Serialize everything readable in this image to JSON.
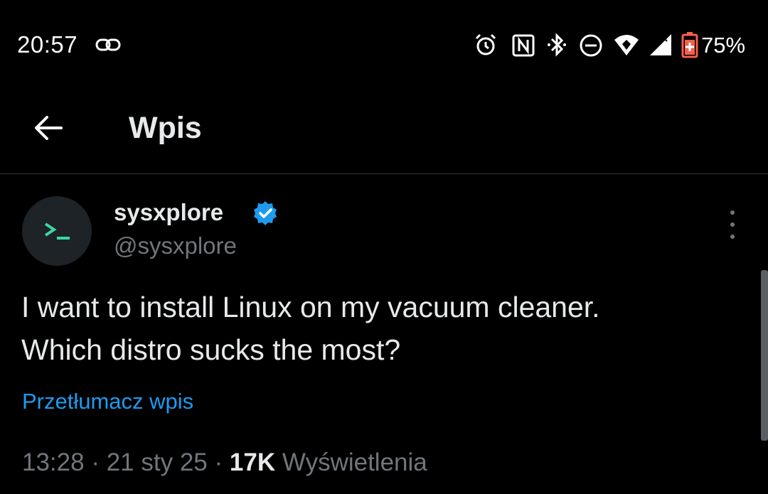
{
  "status_bar": {
    "time": "20:57",
    "battery": "75%",
    "icons": [
      "link-icon",
      "alarm-icon",
      "nfc-icon",
      "bluetooth-icon",
      "do-not-disturb-icon",
      "wifi-icon",
      "signal-icon",
      "battery-icon"
    ]
  },
  "header": {
    "back_icon": "arrow-left-icon",
    "title": "Wpis"
  },
  "post": {
    "author": {
      "display_name": "sysxplore",
      "handle": "@sysxplore",
      "verified": true,
      "avatar_glyph": ">_"
    },
    "text_line_1": "I want to install Linux on my vacuum cleaner.",
    "text_line_2": "Which distro sucks the most?",
    "translate_label": "Przetłumacz wpis",
    "time": "13:28",
    "date": "21 sty 25",
    "separator": "·",
    "views_count": "17K",
    "views_label": "Wyświetlenia"
  },
  "colors": {
    "background": "#000000",
    "text_primary": "#e7e9ea",
    "text_secondary": "#71767b",
    "link": "#1d9bf0",
    "verified": "#1d9bf0",
    "avatar_glyph": "#3dd6a3",
    "battery_accent": "#f4604c"
  }
}
